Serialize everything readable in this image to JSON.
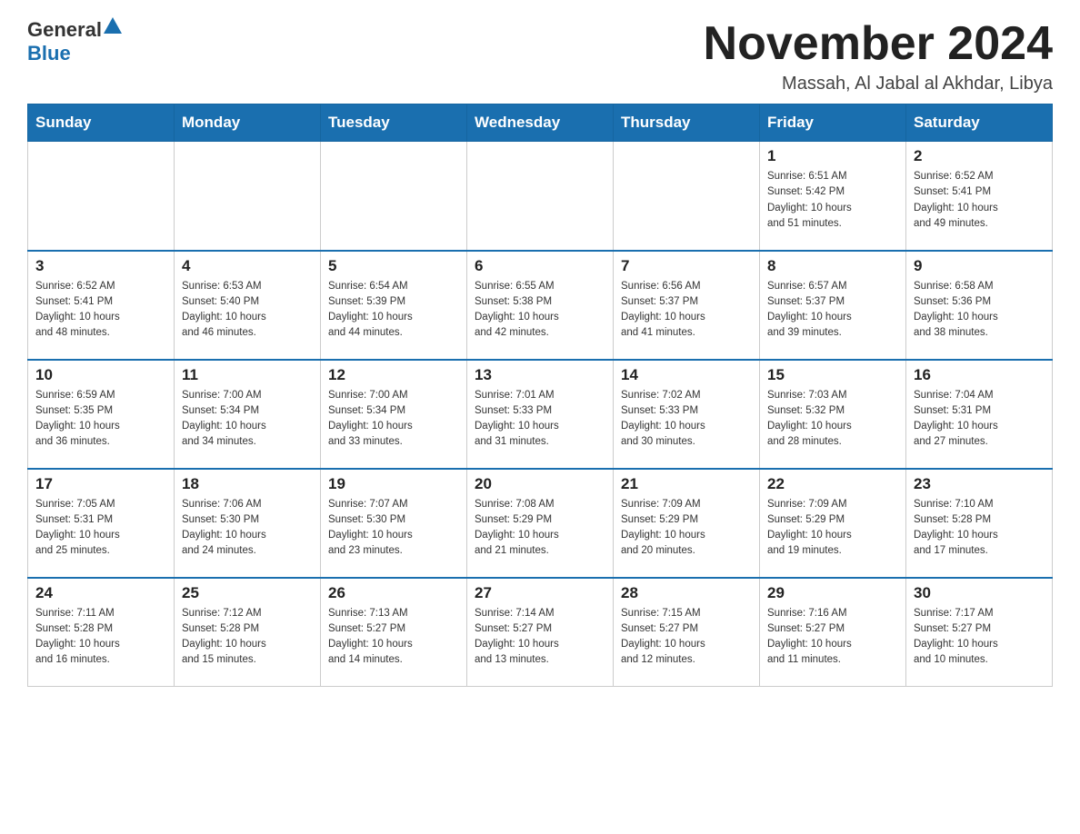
{
  "header": {
    "logo_general": "General",
    "logo_blue": "Blue",
    "month_title": "November 2024",
    "subtitle": "Massah, Al Jabal al Akhdar, Libya"
  },
  "days_of_week": [
    "Sunday",
    "Monday",
    "Tuesday",
    "Wednesday",
    "Thursday",
    "Friday",
    "Saturday"
  ],
  "weeks": [
    [
      {
        "day": "",
        "info": ""
      },
      {
        "day": "",
        "info": ""
      },
      {
        "day": "",
        "info": ""
      },
      {
        "day": "",
        "info": ""
      },
      {
        "day": "",
        "info": ""
      },
      {
        "day": "1",
        "info": "Sunrise: 6:51 AM\nSunset: 5:42 PM\nDaylight: 10 hours\nand 51 minutes."
      },
      {
        "day": "2",
        "info": "Sunrise: 6:52 AM\nSunset: 5:41 PM\nDaylight: 10 hours\nand 49 minutes."
      }
    ],
    [
      {
        "day": "3",
        "info": "Sunrise: 6:52 AM\nSunset: 5:41 PM\nDaylight: 10 hours\nand 48 minutes."
      },
      {
        "day": "4",
        "info": "Sunrise: 6:53 AM\nSunset: 5:40 PM\nDaylight: 10 hours\nand 46 minutes."
      },
      {
        "day": "5",
        "info": "Sunrise: 6:54 AM\nSunset: 5:39 PM\nDaylight: 10 hours\nand 44 minutes."
      },
      {
        "day": "6",
        "info": "Sunrise: 6:55 AM\nSunset: 5:38 PM\nDaylight: 10 hours\nand 42 minutes."
      },
      {
        "day": "7",
        "info": "Sunrise: 6:56 AM\nSunset: 5:37 PM\nDaylight: 10 hours\nand 41 minutes."
      },
      {
        "day": "8",
        "info": "Sunrise: 6:57 AM\nSunset: 5:37 PM\nDaylight: 10 hours\nand 39 minutes."
      },
      {
        "day": "9",
        "info": "Sunrise: 6:58 AM\nSunset: 5:36 PM\nDaylight: 10 hours\nand 38 minutes."
      }
    ],
    [
      {
        "day": "10",
        "info": "Sunrise: 6:59 AM\nSunset: 5:35 PM\nDaylight: 10 hours\nand 36 minutes."
      },
      {
        "day": "11",
        "info": "Sunrise: 7:00 AM\nSunset: 5:34 PM\nDaylight: 10 hours\nand 34 minutes."
      },
      {
        "day": "12",
        "info": "Sunrise: 7:00 AM\nSunset: 5:34 PM\nDaylight: 10 hours\nand 33 minutes."
      },
      {
        "day": "13",
        "info": "Sunrise: 7:01 AM\nSunset: 5:33 PM\nDaylight: 10 hours\nand 31 minutes."
      },
      {
        "day": "14",
        "info": "Sunrise: 7:02 AM\nSunset: 5:33 PM\nDaylight: 10 hours\nand 30 minutes."
      },
      {
        "day": "15",
        "info": "Sunrise: 7:03 AM\nSunset: 5:32 PM\nDaylight: 10 hours\nand 28 minutes."
      },
      {
        "day": "16",
        "info": "Sunrise: 7:04 AM\nSunset: 5:31 PM\nDaylight: 10 hours\nand 27 minutes."
      }
    ],
    [
      {
        "day": "17",
        "info": "Sunrise: 7:05 AM\nSunset: 5:31 PM\nDaylight: 10 hours\nand 25 minutes."
      },
      {
        "day": "18",
        "info": "Sunrise: 7:06 AM\nSunset: 5:30 PM\nDaylight: 10 hours\nand 24 minutes."
      },
      {
        "day": "19",
        "info": "Sunrise: 7:07 AM\nSunset: 5:30 PM\nDaylight: 10 hours\nand 23 minutes."
      },
      {
        "day": "20",
        "info": "Sunrise: 7:08 AM\nSunset: 5:29 PM\nDaylight: 10 hours\nand 21 minutes."
      },
      {
        "day": "21",
        "info": "Sunrise: 7:09 AM\nSunset: 5:29 PM\nDaylight: 10 hours\nand 20 minutes."
      },
      {
        "day": "22",
        "info": "Sunrise: 7:09 AM\nSunset: 5:29 PM\nDaylight: 10 hours\nand 19 minutes."
      },
      {
        "day": "23",
        "info": "Sunrise: 7:10 AM\nSunset: 5:28 PM\nDaylight: 10 hours\nand 17 minutes."
      }
    ],
    [
      {
        "day": "24",
        "info": "Sunrise: 7:11 AM\nSunset: 5:28 PM\nDaylight: 10 hours\nand 16 minutes."
      },
      {
        "day": "25",
        "info": "Sunrise: 7:12 AM\nSunset: 5:28 PM\nDaylight: 10 hours\nand 15 minutes."
      },
      {
        "day": "26",
        "info": "Sunrise: 7:13 AM\nSunset: 5:27 PM\nDaylight: 10 hours\nand 14 minutes."
      },
      {
        "day": "27",
        "info": "Sunrise: 7:14 AM\nSunset: 5:27 PM\nDaylight: 10 hours\nand 13 minutes."
      },
      {
        "day": "28",
        "info": "Sunrise: 7:15 AM\nSunset: 5:27 PM\nDaylight: 10 hours\nand 12 minutes."
      },
      {
        "day": "29",
        "info": "Sunrise: 7:16 AM\nSunset: 5:27 PM\nDaylight: 10 hours\nand 11 minutes."
      },
      {
        "day": "30",
        "info": "Sunrise: 7:17 AM\nSunset: 5:27 PM\nDaylight: 10 hours\nand 10 minutes."
      }
    ]
  ]
}
